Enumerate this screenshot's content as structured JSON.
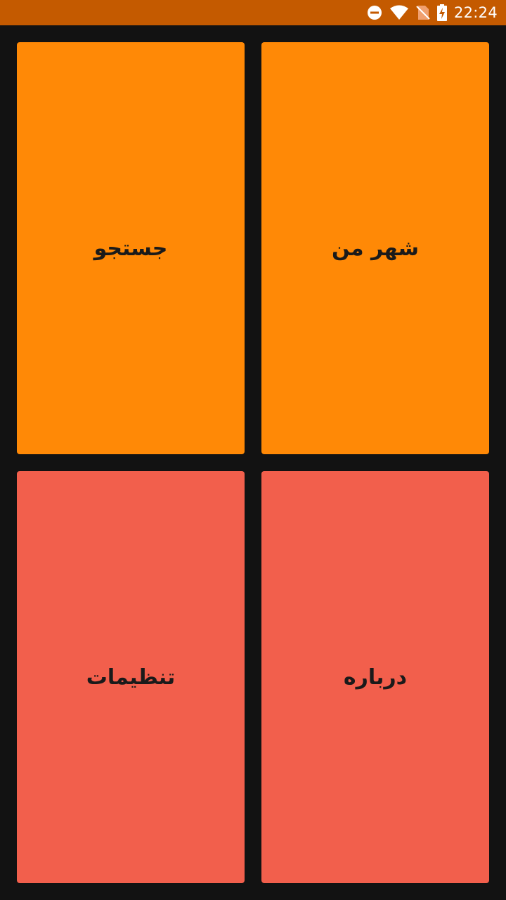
{
  "status_bar": {
    "time": "22:24",
    "icons": [
      "do-not-disturb-icon",
      "wifi-icon",
      "no-sim-icon",
      "battery-charging-icon"
    ],
    "background": "#c45a00"
  },
  "tiles": {
    "my_city": {
      "label": "شهر من",
      "color": "#ff8906"
    },
    "search": {
      "label": "جستجو",
      "color": "#ff8906"
    },
    "about": {
      "label": "درباره",
      "color": "#f25f4c"
    },
    "settings": {
      "label": "تنظیمات",
      "color": "#f25f4c"
    }
  },
  "colors": {
    "background": "#121212",
    "label_text": "#1a1a1a"
  }
}
